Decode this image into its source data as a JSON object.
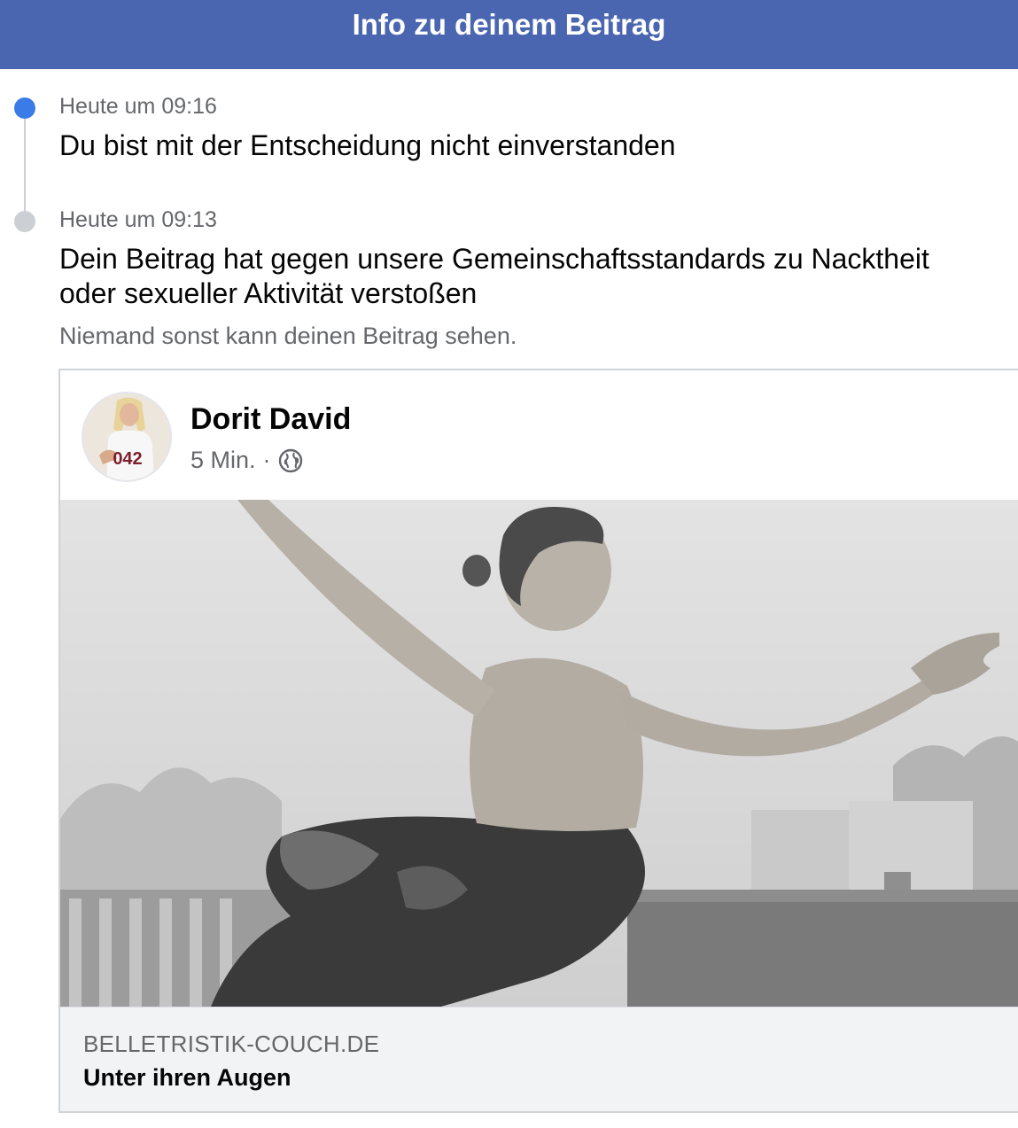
{
  "header": {
    "title": "Info zu deinem Beitrag"
  },
  "timeline": [
    {
      "timestamp": "Heute um 09:16",
      "message": "Du bist mit der Entscheidung nicht einverstanden"
    },
    {
      "timestamp": "Heute um 09:13",
      "message_line1": "Dein Beitrag hat gegen unsere Gemeinschaftsstandards zu Nacktheit",
      "message_line2": "oder sexueller Aktivität verstoßen",
      "note": "Niemand sonst kann deinen Beitrag sehen."
    }
  ],
  "post": {
    "author": "Dorit David",
    "time": "5 Min.",
    "separator": "·",
    "privacy_icon": "globe-icon",
    "avatar_badge": "042",
    "link": {
      "domain": "BELLETRISTIK-COUCH.DE",
      "title": "Unter ihren Augen"
    }
  },
  "colors": {
    "header_bg": "#4a66b0",
    "active_dot": "#3b7be8",
    "inactive_dot": "#ccd0d5"
  }
}
